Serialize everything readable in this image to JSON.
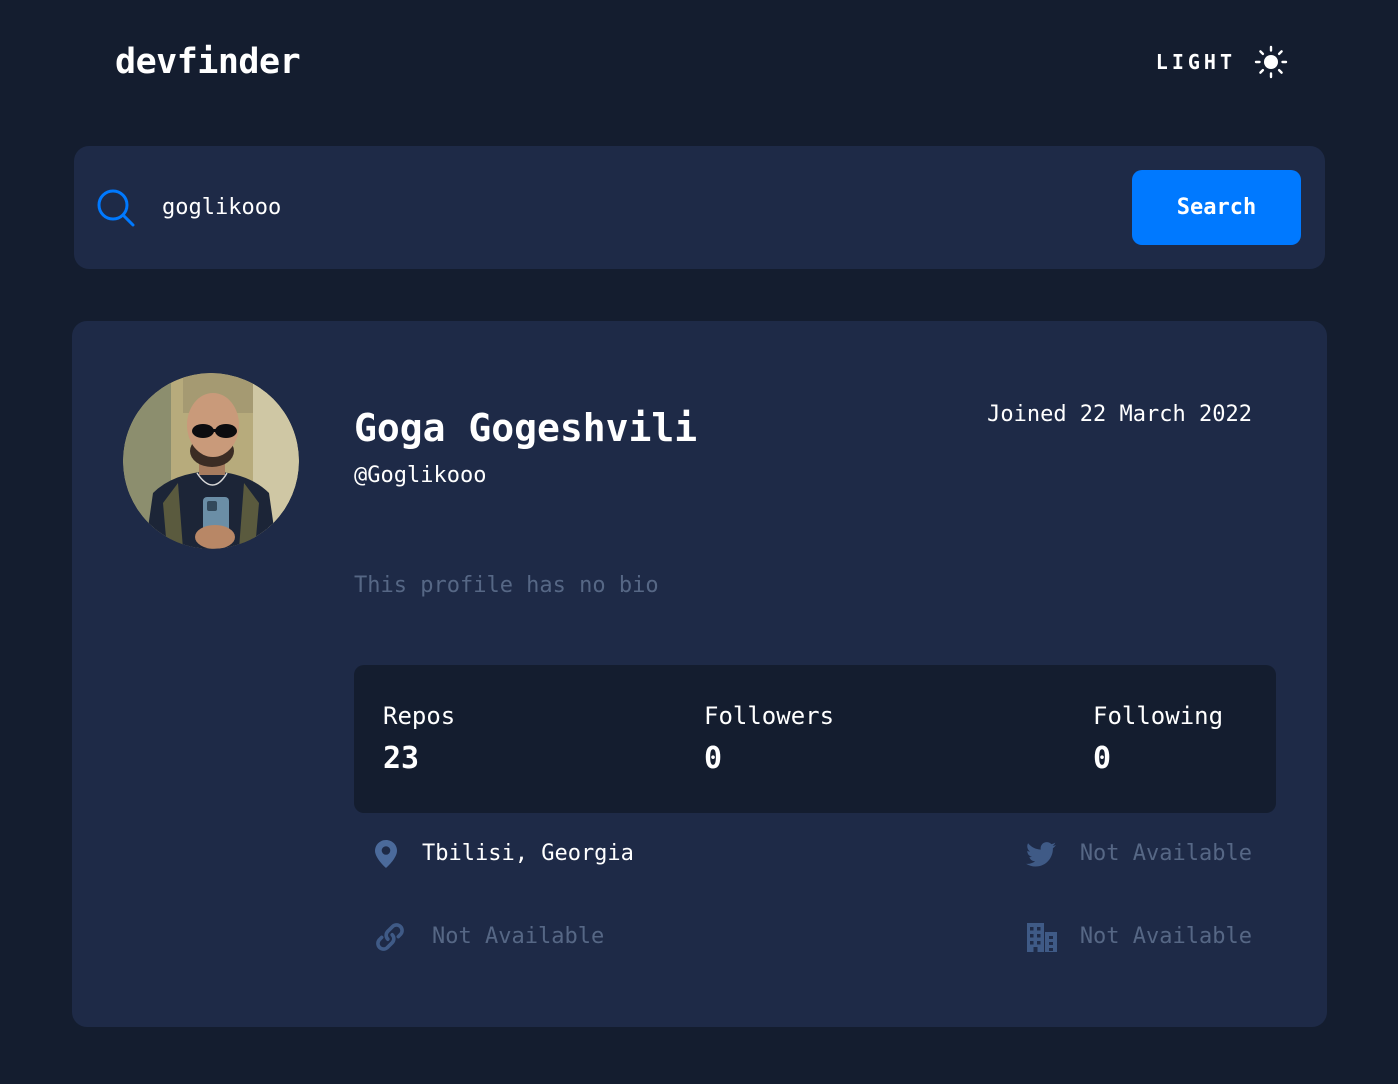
{
  "header": {
    "logo": "devfinder",
    "theme_label": "LIGHT",
    "theme_icon": "sun-icon"
  },
  "search": {
    "icon": "search-icon",
    "value": "goglikooo",
    "button_label": "Search"
  },
  "profile": {
    "name": "Goga Gogeshvili",
    "login": "@Goglikooo",
    "joined": "Joined 22 March 2022",
    "bio": "This profile has no bio",
    "stats": {
      "repos_label": "Repos",
      "repos_value": "23",
      "followers_label": "Followers",
      "followers_value": "0",
      "following_label": "Following",
      "following_value": "0"
    },
    "links": {
      "location": {
        "icon": "location-pin-icon",
        "text": "Tbilisi, Georgia"
      },
      "blog": {
        "icon": "link-icon",
        "text": "Not Available"
      },
      "twitter": {
        "icon": "twitter-icon",
        "text": "Not Available"
      },
      "company": {
        "icon": "company-building-icon",
        "text": "Not Available"
      }
    }
  },
  "colors": {
    "background": "#141d2f",
    "card": "#1e2a47",
    "accent": "#0079ff",
    "muted": "#697c9a",
    "text": "#ffffff"
  }
}
